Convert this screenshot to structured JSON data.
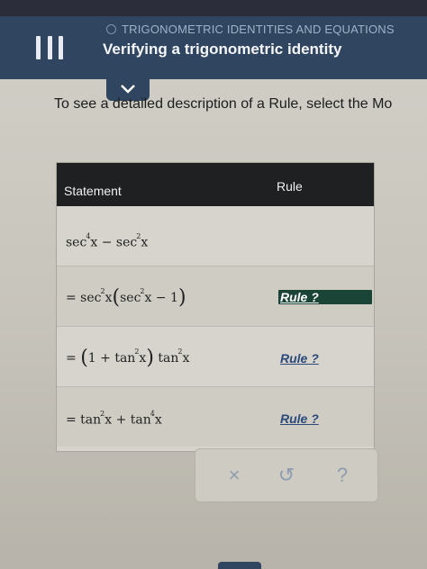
{
  "header": {
    "section": "TRIGONOMETRIC IDENTITIES AND EQUATIONS",
    "title": "Verifying a trigonometric identity",
    "menu_icon": "hamburger-menu-icon",
    "status_icon": "circle-progress-icon",
    "expand_icon": "chevron-down-icon"
  },
  "instructions": "To see a detailed description of a Rule, select the Mo",
  "table": {
    "headers": {
      "statement": "Statement",
      "rule": "Rule"
    },
    "rows": [
      {
        "statement": "sec⁴x − sec²x",
        "rule": ""
      },
      {
        "statement": "= sec²x (sec²x − 1)",
        "rule": "Rule ?",
        "active": true
      },
      {
        "statement": "= (1 + tan²x) tan²x",
        "rule": "Rule ?"
      },
      {
        "statement": "= tan²x + tan⁴x",
        "rule": "Rule ?"
      }
    ]
  },
  "actions": {
    "clear": "×",
    "undo": "↺",
    "help": "?"
  },
  "colors": {
    "header_bg": "#2f4560",
    "table_header_bg": "#1f2022",
    "active_rule_bg": "#1a4536",
    "link": "#2c4a7a"
  }
}
